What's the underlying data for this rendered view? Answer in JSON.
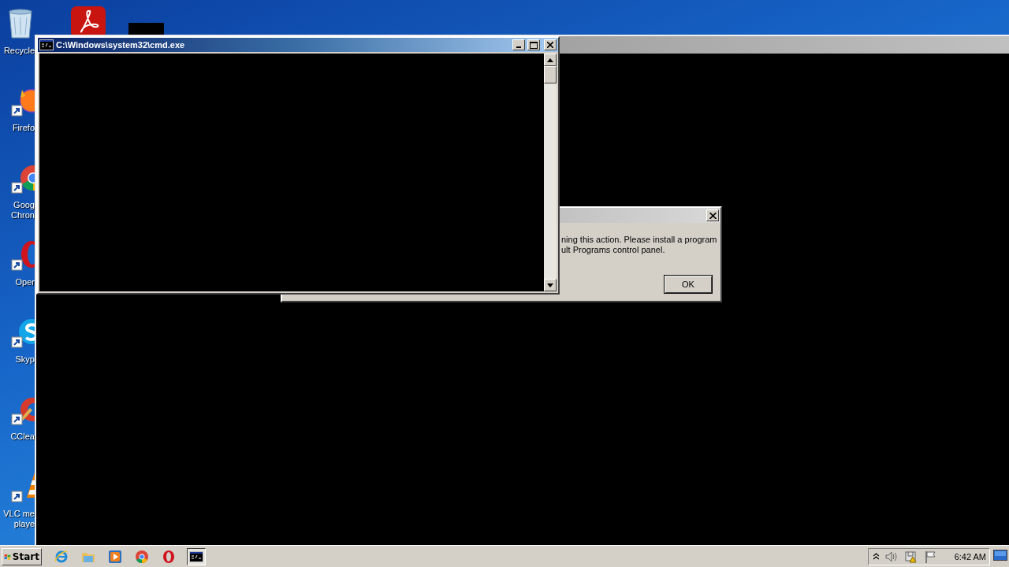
{
  "desktop_icons": [
    {
      "kind": "recycle",
      "lines": [
        "Recycle"
      ]
    },
    {
      "kind": "firefox",
      "lines": [
        "Firefo"
      ]
    },
    {
      "kind": "chrome",
      "lines": [
        "Goog",
        "Chron"
      ]
    },
    {
      "kind": "opera",
      "lines": [
        "Oper"
      ]
    },
    {
      "kind": "skype",
      "lines": [
        "Skyp"
      ]
    },
    {
      "kind": "ccleaner",
      "lines": [
        "CClea"
      ]
    },
    {
      "kind": "vlc",
      "lines": [
        "VLC me",
        "playe"
      ]
    }
  ],
  "top_icons": [
    {
      "kind": "acrobat"
    },
    {
      "kind": "blank"
    }
  ],
  "cmd_window": {
    "title": "C:\\Windows\\system32\\cmd.exe"
  },
  "dialog": {
    "message_lines": [
      "ning this action. Please install a program",
      "ult Programs control panel."
    ],
    "button": "OK"
  },
  "taskbar": {
    "start": "Start",
    "quick_launch": [
      {
        "kind": "ie"
      },
      {
        "kind": "folder"
      },
      {
        "kind": "media"
      },
      {
        "kind": "chrome"
      },
      {
        "kind": "opera"
      }
    ],
    "tasks": [
      {
        "kind": "cmd",
        "selected": true
      }
    ],
    "clock": "6:42 AM"
  }
}
